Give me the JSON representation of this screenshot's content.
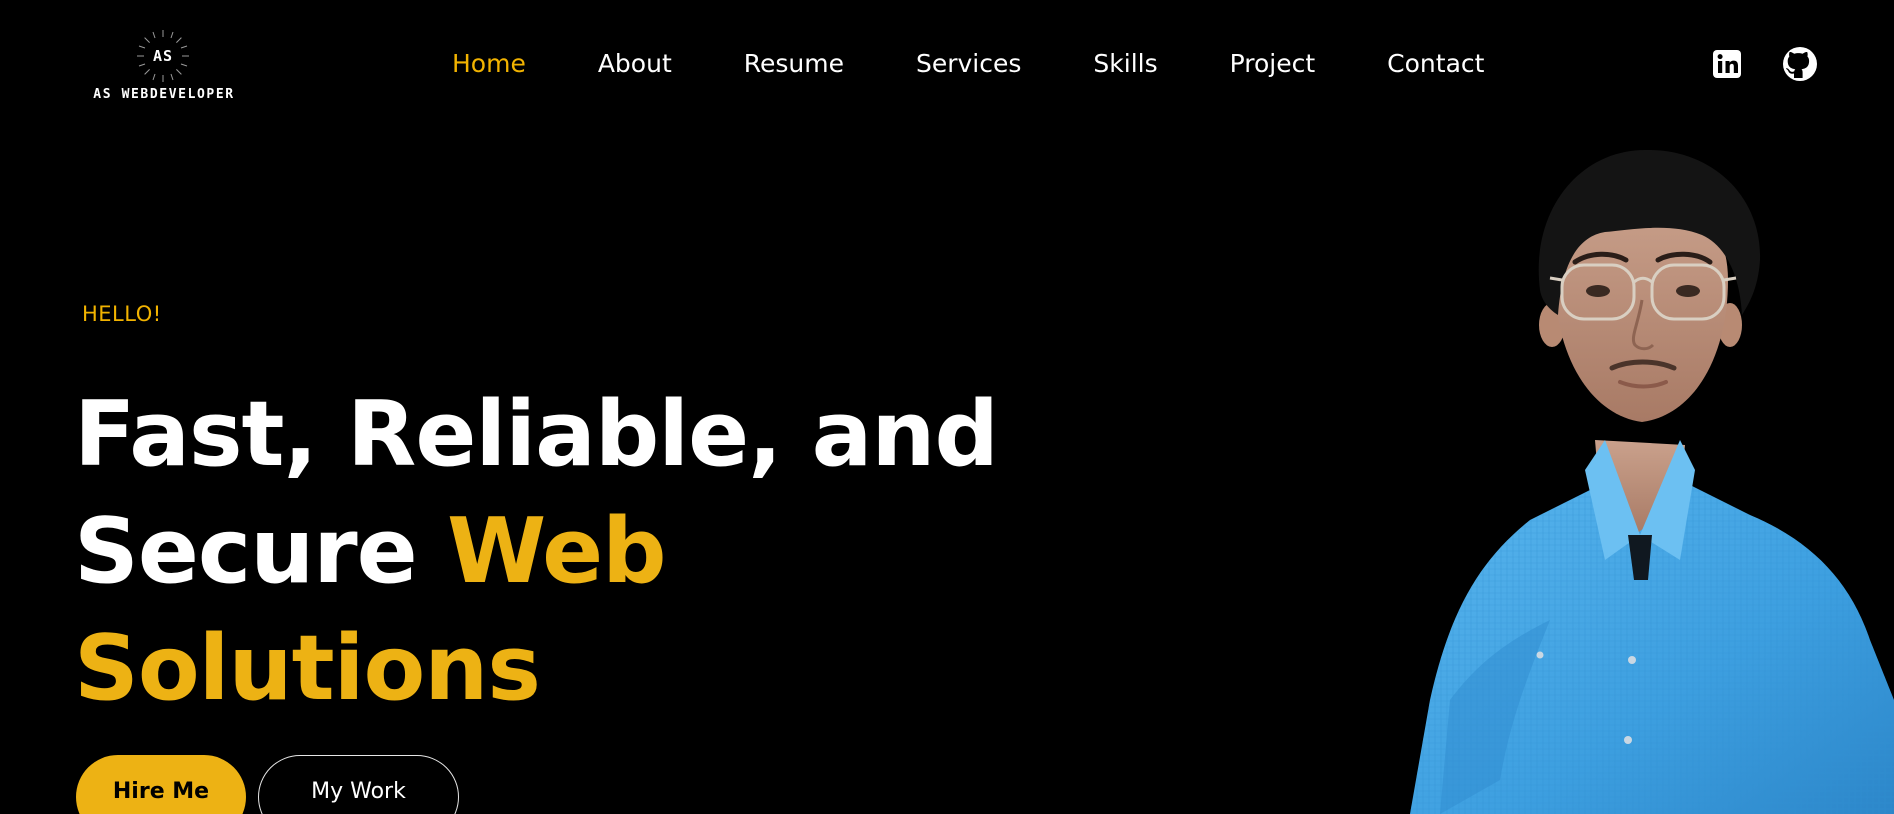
{
  "brand": {
    "logo_initials": "AS",
    "logo_text": "AS WEBDEVELOPER"
  },
  "nav": {
    "items": [
      {
        "label": "Home",
        "active": true
      },
      {
        "label": "About",
        "active": false
      },
      {
        "label": "Resume",
        "active": false
      },
      {
        "label": "Services",
        "active": false
      },
      {
        "label": "Skills",
        "active": false
      },
      {
        "label": "Project",
        "active": false
      },
      {
        "label": "Contact",
        "active": false
      }
    ]
  },
  "social": {
    "icons": [
      "linkedin-icon",
      "github-icon"
    ]
  },
  "hero": {
    "greeting": "HELLO!",
    "headline_line1": "Fast, Reliable, and",
    "headline_line2_white": "Secure ",
    "headline_line2_accent": "Web",
    "headline_line3_accent": "Solutions",
    "primary_button": "Hire Me",
    "secondary_button": "My Work"
  },
  "colors": {
    "background": "#000000",
    "accent": "#edb214",
    "nav_active": "#f2b300",
    "text": "#ffffff"
  }
}
